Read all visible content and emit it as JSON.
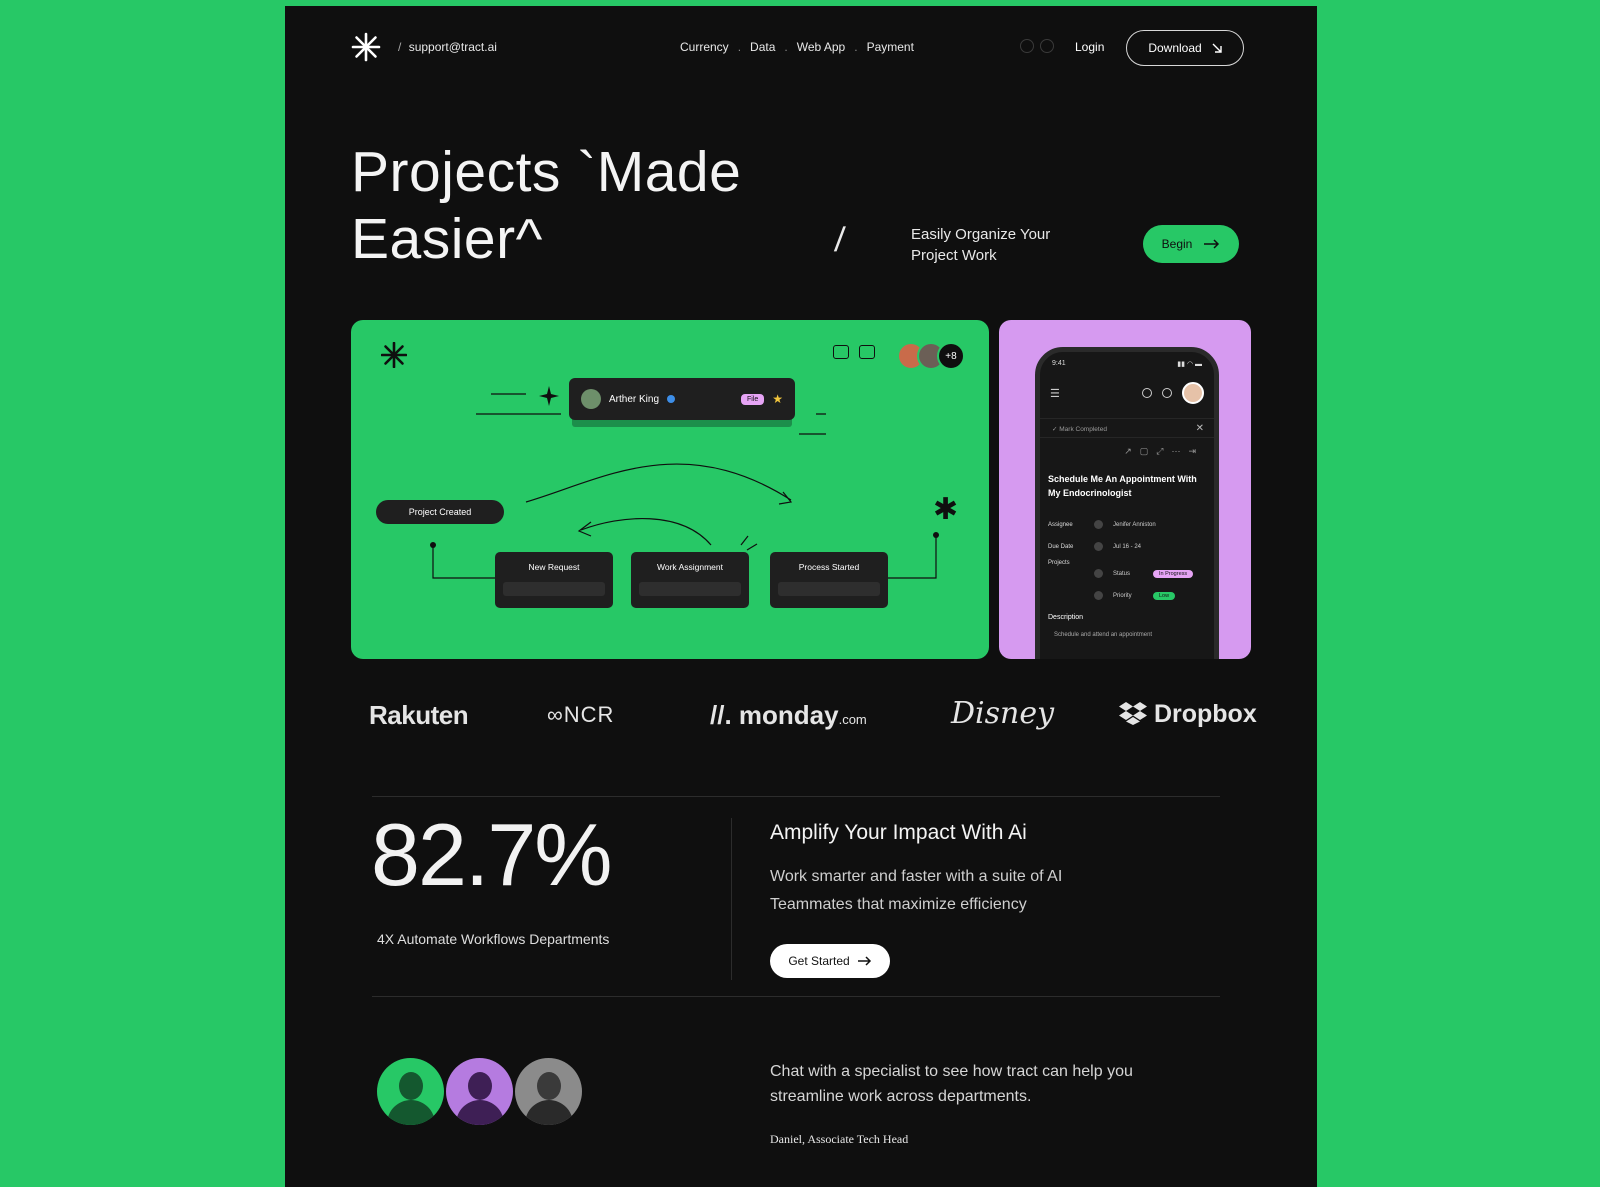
{
  "nav": {
    "support_prefix": "/",
    "support_email": "support@tract.ai",
    "menu": [
      "Currency",
      "Data",
      "Web App",
      "Payment"
    ],
    "menu_separator": ".",
    "login": "Login",
    "download": "Download"
  },
  "hero": {
    "title_line1": "Projects `Made",
    "title_line2": "Easier^",
    "slash": "/",
    "subtitle": "Easily Organize Your Project Work",
    "cta": "Begin"
  },
  "board": {
    "user_name": "Arther King",
    "user_tag": "File",
    "more_count": "+8",
    "project_created": "Project Created",
    "steps": [
      "New Request",
      "Work Assignment",
      "Process Started"
    ]
  },
  "phone": {
    "time": "9:41",
    "mark_completed": "✓  Mark Completed",
    "task_title": "Schedule Me An Appointment With My Endocrinologist",
    "assignee_label": "Assignee",
    "assignee_value": "Jenifer Anniston",
    "due_label": "Due Date",
    "due_value": "Jul 16 - 24",
    "projects_label": "Projects",
    "status_label": "Status",
    "status_value": "In Progress",
    "priority_label": "Priority",
    "priority_value": "Low",
    "description_label": "Description",
    "description_value": "Schedule and attend an appointment"
  },
  "logos": {
    "rakuten": "Rakuten",
    "ncr": "NCR",
    "monday": "monday",
    "monday_suffix": ".com",
    "disney": "Disney",
    "dropbox": "Dropbox"
  },
  "stats": {
    "big_value": "82.7%",
    "label": "4X Automate Workflows Departments",
    "heading": "Amplify Your Impact With Ai",
    "text": "Work smarter and faster with a suite of AI Teammates that maximize efficiency",
    "cta": "Get Started"
  },
  "specialist": {
    "text": "Chat with a specialist to see how tract can help you streamline work across departments.",
    "author": "Daniel, Associate Tech Head"
  },
  "colors": {
    "background": "#27c866",
    "page": "#0f0f0f",
    "accent_green": "#27c866",
    "accent_purple": "#d69af0"
  },
  "icons": [
    "asterisk-logo-icon",
    "arrow-down-right-icon",
    "arrow-right-icon",
    "dropbox-icon",
    "globe-icon"
  ]
}
